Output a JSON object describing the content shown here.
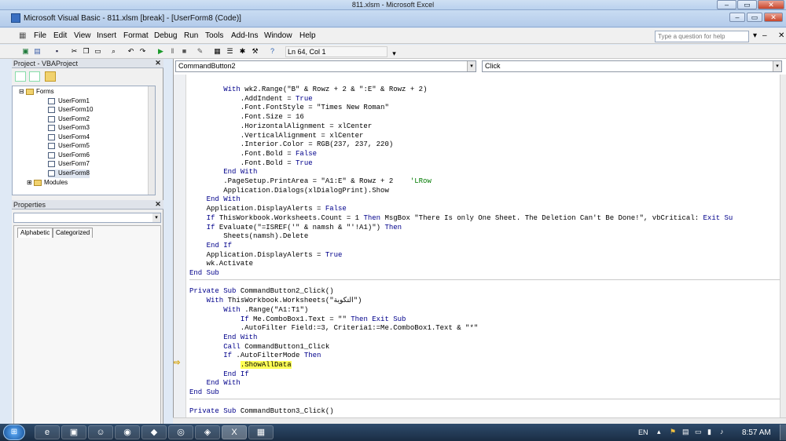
{
  "excel_title": "811.xlsm - Microsoft Excel",
  "window_title": "Microsoft Visual Basic - 811.xlsm [break] - [UserForm8 (Code)]",
  "menu": [
    "File",
    "Edit",
    "View",
    "Insert",
    "Format",
    "Debug",
    "Run",
    "Tools",
    "Add-Ins",
    "Window",
    "Help"
  ],
  "help_placeholder": "Type a question for help",
  "status_pos": "Ln 64, Col 1",
  "project_panel": {
    "title": "Project - VBAProject",
    "forms_label": "Forms",
    "items": [
      "UserForm1",
      "UserForm10",
      "UserForm2",
      "UserForm3",
      "UserForm4",
      "UserForm5",
      "UserForm6",
      "UserForm7",
      "UserForm8"
    ],
    "modules_label": "Modules"
  },
  "properties_panel": {
    "title": "Properties",
    "tab_alphabetic": "Alphabetic",
    "tab_categorized": "Categorized"
  },
  "code_window": {
    "object_combo": "CommandButton2",
    "proc_combo": "Click"
  },
  "taskbar": {
    "lang": "EN",
    "time": "8:57 AM"
  }
}
